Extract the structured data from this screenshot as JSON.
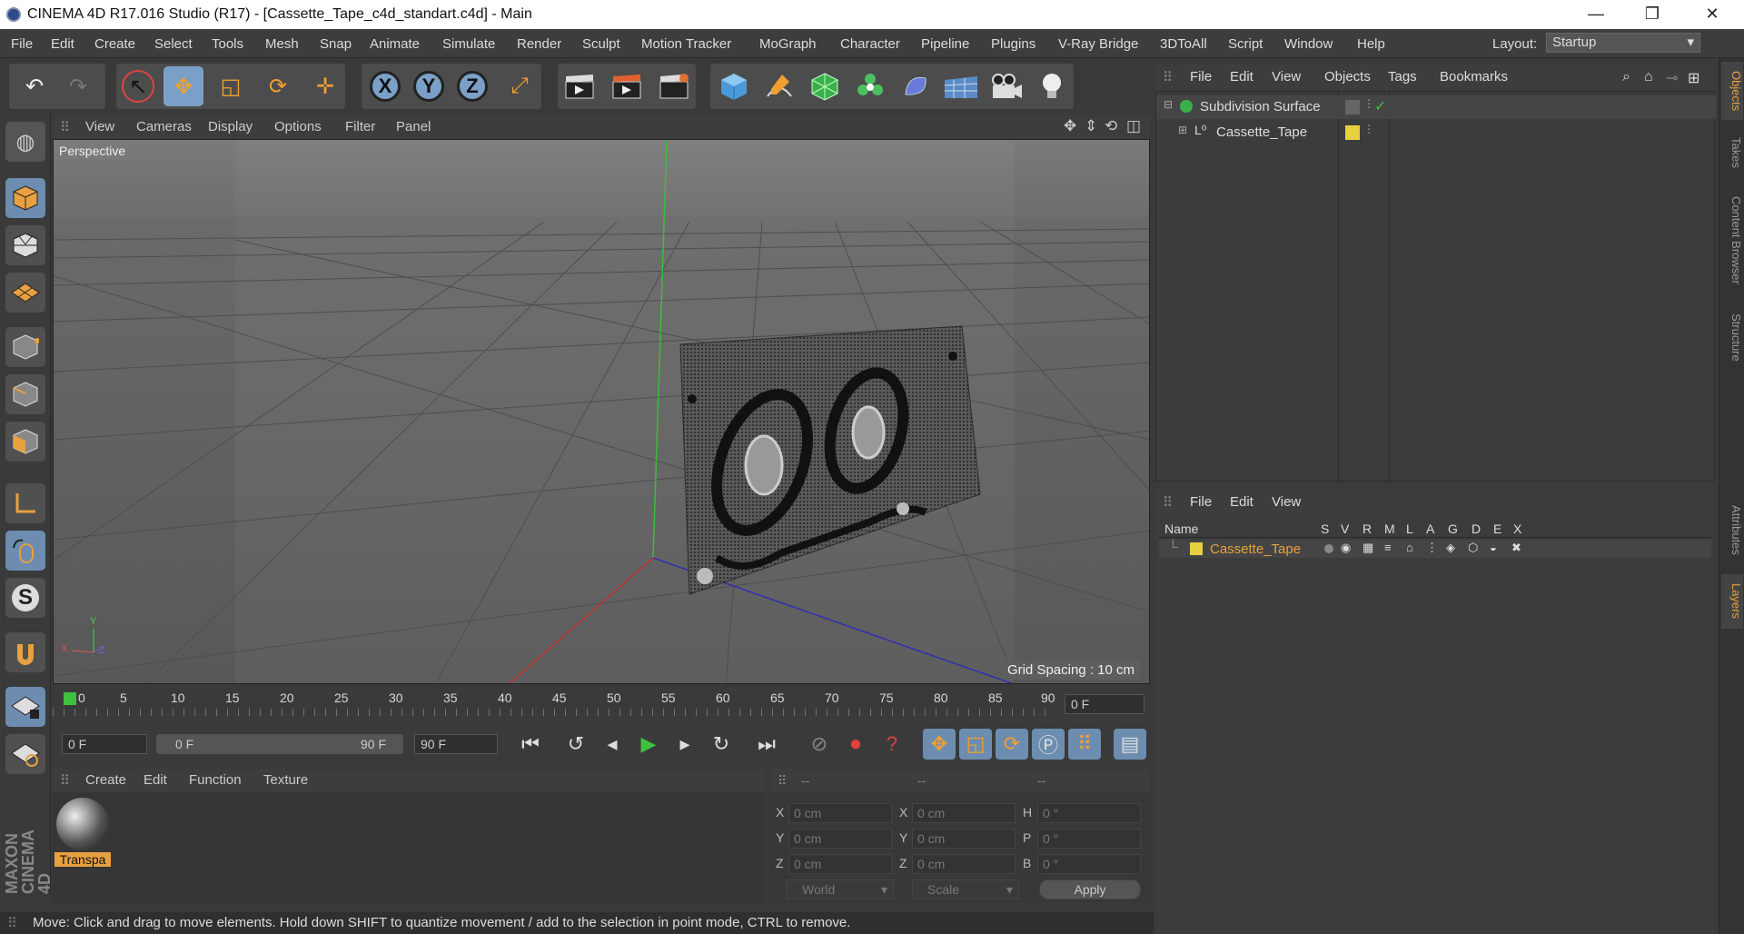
{
  "title": "CINEMA 4D R17.016 Studio (R17) - [Cassette_Tape_c4d_standart.c4d] - Main",
  "window_controls": {
    "minimize": "—",
    "maximize": "❐",
    "close": "✕"
  },
  "menu": [
    "File",
    "Edit",
    "Create",
    "Select",
    "Tools",
    "Mesh",
    "Snap",
    "Animate",
    "Simulate",
    "Render",
    "Sculpt",
    "Motion Tracker",
    "MoGraph",
    "Character",
    "Pipeline",
    "Plugins",
    "V-Ray Bridge",
    "3DToAll",
    "Script",
    "Window",
    "Help"
  ],
  "layout": {
    "label": "Layout:",
    "value": "Startup"
  },
  "toolbar_icons": {
    "undo": "↶",
    "redo": "↷",
    "select": "↖",
    "move": "✥",
    "scale": "◱",
    "rotate": "⟳",
    "axis": "✛",
    "x": "X",
    "y": "Y",
    "z": "Z",
    "world": "⤢"
  },
  "viewport": {
    "menu": [
      "View",
      "Cameras",
      "Display",
      "Options",
      "Filter",
      "Panel"
    ],
    "label": "Perspective",
    "grid_spacing": "Grid Spacing : 10 cm",
    "axis_x": "X",
    "axis_y": "Y",
    "axis_z": "Z"
  },
  "timeline": {
    "ticks": [
      "0",
      "5",
      "10",
      "15",
      "20",
      "25",
      "30",
      "35",
      "40",
      "45",
      "50",
      "55",
      "60",
      "65",
      "70",
      "75",
      "80",
      "85",
      "90"
    ],
    "current": "0 F"
  },
  "transport": {
    "start": "0 F",
    "range_start": "0 F",
    "range_end": "90 F",
    "end": "90 F"
  },
  "materials": {
    "menu": [
      "Create",
      "Edit",
      "Function",
      "Texture"
    ],
    "item": "Transpa"
  },
  "coords": {
    "headers": [
      "--",
      "--",
      "--"
    ],
    "rows": [
      {
        "a": "X",
        "av": "0 cm",
        "b": "X",
        "bv": "0 cm",
        "c": "H",
        "cv": "0 °"
      },
      {
        "a": "Y",
        "av": "0 cm",
        "b": "Y",
        "bv": "0 cm",
        "c": "P",
        "cv": "0 °"
      },
      {
        "a": "Z",
        "av": "0 cm",
        "b": "Z",
        "bv": "0 cm",
        "c": "B",
        "cv": "0 °"
      }
    ],
    "mode": "World",
    "transform": "Scale",
    "apply": "Apply"
  },
  "status": "Move: Click and drag to move elements. Hold down SHIFT to quantize movement / add to the selection in point mode, CTRL to remove.",
  "objects": {
    "menu": [
      "File",
      "Edit",
      "View",
      "Objects",
      "Tags",
      "Bookmarks"
    ],
    "items": [
      "Subdivision Surface",
      "Cassette_Tape"
    ]
  },
  "layers": {
    "menu": [
      "File",
      "Edit",
      "View"
    ],
    "columns": [
      "Name",
      "S",
      "V",
      "R",
      "M",
      "L",
      "A",
      "G",
      "D",
      "E",
      "X"
    ],
    "item": "Cassette_Tape"
  },
  "side_tabs": [
    "Objects",
    "Takes",
    "Content Browser",
    "Structure",
    "Attributes",
    "Layers"
  ],
  "brand": "MAXON CINEMA 4D"
}
